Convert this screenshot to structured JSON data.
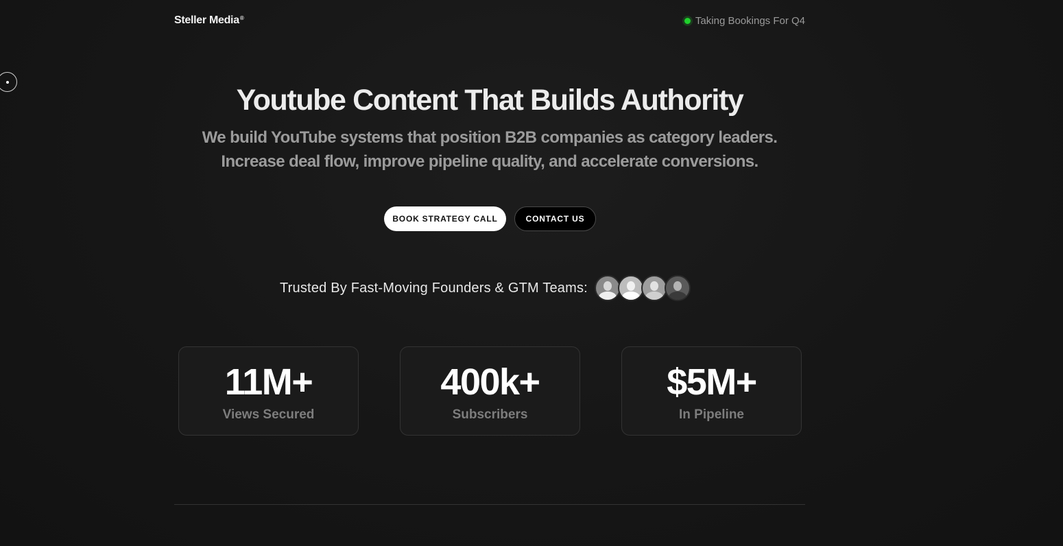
{
  "nav": {
    "logo": "Steller Media",
    "logo_mark": "®",
    "status_text": "Taking Bookings For Q4",
    "status_color": "#1fd12c"
  },
  "hero": {
    "title": "Youtube Content That Builds Authority",
    "subtitle_line1": "We build YouTube systems that position B2B companies as category leaders.",
    "subtitle_line2": "Increase deal flow, improve pipeline quality, and accelerate conversions."
  },
  "cta": {
    "primary_label": "BOOK STRATEGY CALL",
    "secondary_label": "CONTACT US"
  },
  "trusted": {
    "text": "Trusted By Fast-Moving Founders & GTM Teams:",
    "avatars": [
      "avatar-1",
      "avatar-2",
      "avatar-3",
      "avatar-4"
    ]
  },
  "stats": [
    {
      "value": "11M+",
      "label": "Views Secured"
    },
    {
      "value": "400k+",
      "label": "Subscribers"
    },
    {
      "value": "$5M+",
      "label": "In Pipeline"
    }
  ]
}
